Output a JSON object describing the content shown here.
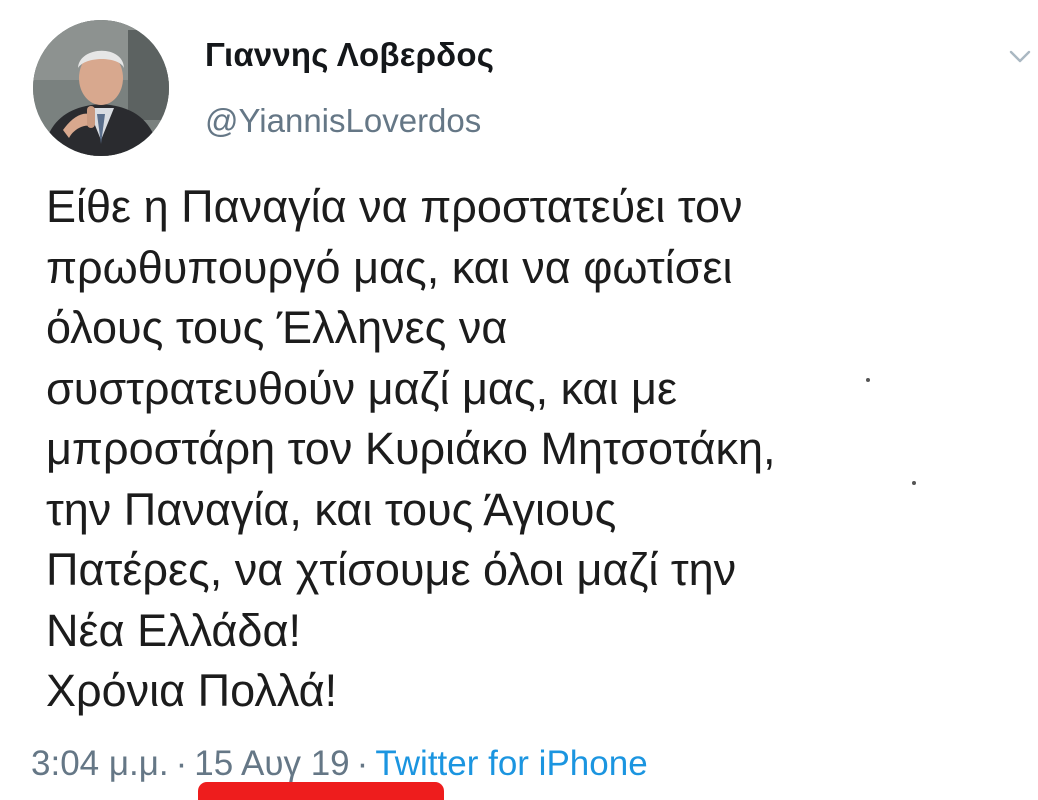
{
  "tweet": {
    "author": {
      "display_name": "Γιαννης Λοβερδος",
      "handle": "@YiannisLoverdos",
      "avatar_icon": "profile-photo"
    },
    "menu_icon": "chevron-down-icon",
    "body_lines": [
      "Είθε η Παναγία να προστατεύει τον",
      "πρωθυπουργό μας, και να φωτίσει",
      "όλους τους Έλληνες να",
      "συστρατευθούν μαζί μας, και με",
      "μπροστάρη τον Κυριάκο Μητσοτάκη,",
      "την Παναγία, και τους Άγιους",
      "Πατέρες, να χτίσουμε όλοι μαζί την",
      "Νέα Ελλάδα!",
      "Χρόνια Πολλά!"
    ],
    "meta": {
      "time": "3:04 μ.μ.",
      "separator": "·",
      "date": "15 Αυγ 19",
      "source": "Twitter for iPhone"
    },
    "colors": {
      "text": "#14171a",
      "secondary": "#657786",
      "link": "#1b95e0",
      "highlight": "#ee1d1d"
    }
  }
}
